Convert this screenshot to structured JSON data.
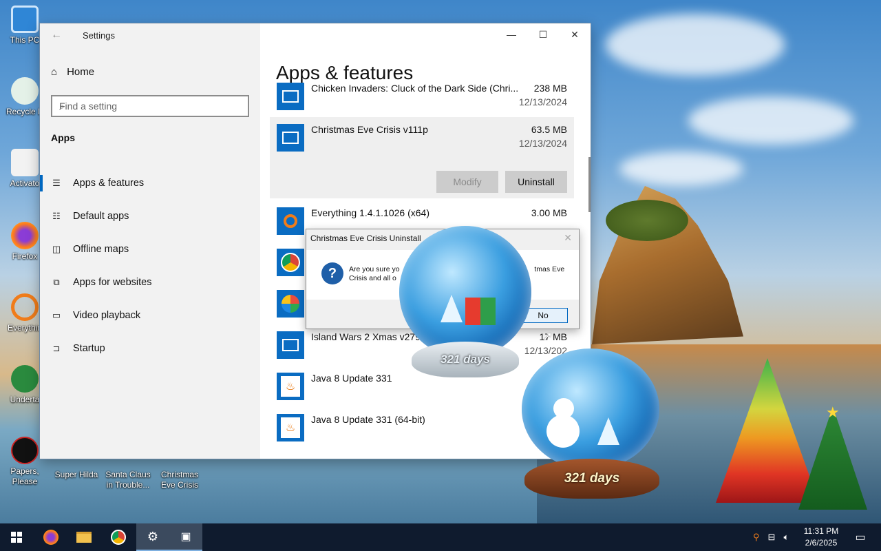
{
  "desktop": {
    "icons": [
      {
        "label": "This PC"
      },
      {
        "label": "Recycle B"
      },
      {
        "label": "Activato"
      },
      {
        "label": "Firefox"
      },
      {
        "label": "Everythin"
      },
      {
        "label": "Underta"
      },
      {
        "label": "Papers, Please"
      },
      {
        "label": "Super Hilda"
      },
      {
        "label": "Santa Claus in Trouble..."
      },
      {
        "label": "Christmas Eve Crisis"
      }
    ]
  },
  "settings": {
    "title": "Settings",
    "home_label": "Home",
    "search_placeholder": "Find a setting",
    "section_label": "Apps",
    "nav": [
      {
        "label": "Apps & features",
        "icon": "list-icon",
        "glyph": "☰"
      },
      {
        "label": "Default apps",
        "icon": "default-apps-icon",
        "glyph": "☷"
      },
      {
        "label": "Offline maps",
        "icon": "map-icon",
        "glyph": "◫"
      },
      {
        "label": "Apps for websites",
        "icon": "link-icon",
        "glyph": "⧉"
      },
      {
        "label": "Video playback",
        "icon": "video-icon",
        "glyph": "▭"
      },
      {
        "label": "Startup",
        "icon": "startup-icon",
        "glyph": "⊐"
      }
    ],
    "page_title": "Apps & features",
    "apps": [
      {
        "name": "Chicken Invaders: Cluck of the Dark Side (Chri...",
        "size": "238 MB",
        "date": "12/13/2024",
        "icon": "window-app-icon"
      },
      {
        "name": "Christmas Eve Crisis v111p",
        "size": "63.5 MB",
        "date": "12/13/2024",
        "icon": "window-app-icon"
      },
      {
        "name": "Everything 1.4.1.1026 (x64)",
        "size": "3.00 MB",
        "date": "",
        "icon": "everything-icon"
      },
      {
        "name": "",
        "size": "",
        "date": "",
        "icon": "chrome-icon"
      },
      {
        "name": "",
        "size": "",
        "date": "",
        "icon": "installer-icon"
      },
      {
        "name": "Island Wars 2 Xmas v279c",
        "size": "17 MB",
        "date": "12/13/202",
        "icon": "window-app-icon"
      },
      {
        "name": "Java 8 Update 331",
        "size": "",
        "date": "",
        "icon": "java-icon"
      },
      {
        "name": "Java 8 Update 331 (64-bit)",
        "size": "",
        "date": "",
        "icon": "java-icon"
      }
    ],
    "modify_label": "Modify",
    "uninstall_label": "Uninstall"
  },
  "dialog": {
    "title": "Christmas Eve Crisis Uninstall",
    "message_start": "Are you sure yo",
    "message_end": "tmas Eve",
    "message_line2": "Crisis and all o",
    "no_label": "No"
  },
  "globes": {
    "top_label": "321 days",
    "bottom_label": "321 days"
  },
  "taskbar": {
    "time": "11:31 PM",
    "date": "2/6/2025"
  },
  "colors": {
    "accent": "#0067c0",
    "taskbar": "#0f1b2e"
  }
}
